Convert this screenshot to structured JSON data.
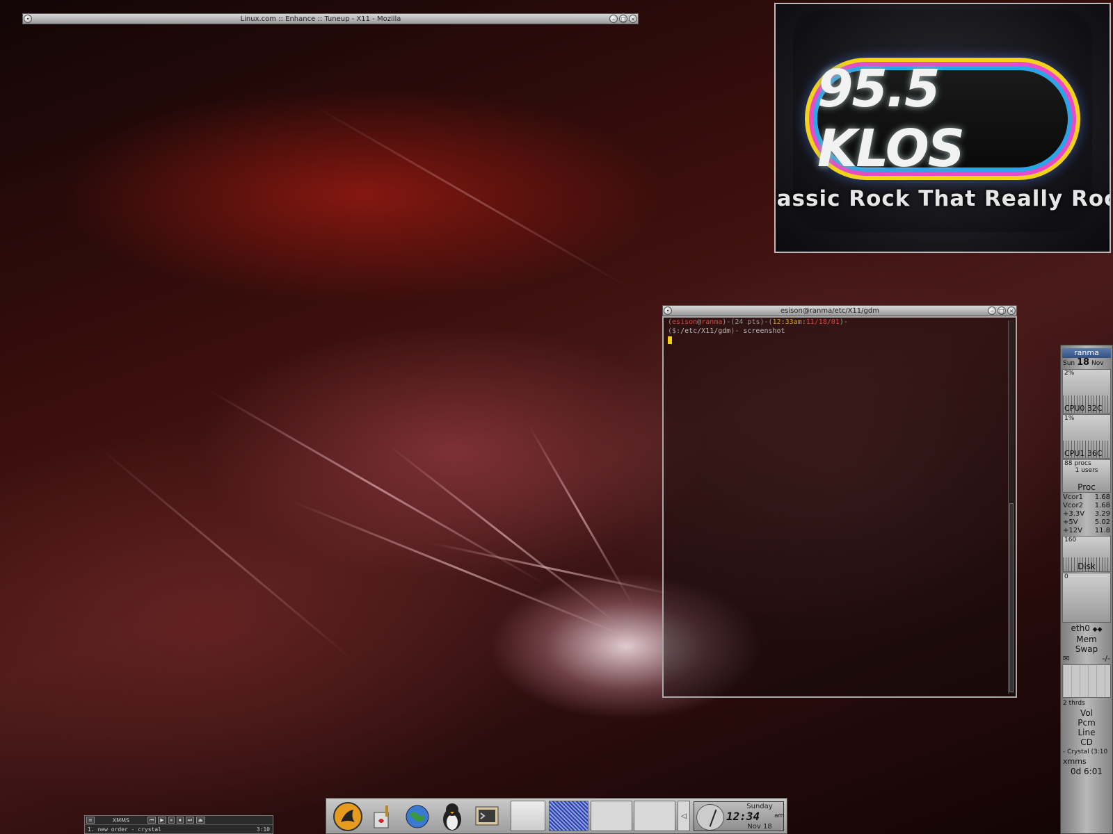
{
  "mozilla": {
    "title": "Linux.com :: Enhance :: Tuneup - X11 - Mozilla"
  },
  "video": {
    "logo": "95.5 KLOS",
    "slogan": "lassic Rock That Really Rock"
  },
  "terminal": {
    "title": "esison@ranma/etc/X11/gdm",
    "prompt_user": "esison",
    "prompt_host": "ranma",
    "prompt_tty": "24 pts",
    "prompt_time": "12:33am",
    "prompt_date": "11/18/01",
    "prompt_cwd": "/etc/X11/gdm",
    "command": "screenshot"
  },
  "gkrellm": {
    "host": "ranma",
    "day": "Sun",
    "date": "18",
    "month": "Nov",
    "cpu0_pct": "2%",
    "cpu0_label": "CPU0",
    "cpu0_temp": "32C",
    "cpu1_pct": "1%",
    "cpu1_label": "CPU1",
    "cpu1_temp": "36C",
    "procs": "88 procs",
    "users": "1 users",
    "proc_label": "Proc",
    "sensors": [
      {
        "name": "Vcor1",
        "value": "1.68"
      },
      {
        "name": "Vcor2",
        "value": "1.68"
      },
      {
        "name": "+3.3V",
        "value": "3.29"
      },
      {
        "name": "+5V",
        "value": "5.02"
      },
      {
        "name": "+12V",
        "value": "11.8"
      }
    ],
    "proc_scale": "160",
    "disk_label": "Disk",
    "disk_scale": "0",
    "net_label": "eth0",
    "mem_label": "Mem",
    "swap_label": "Swap",
    "mail_label": "-/-",
    "threads": "2 thrds",
    "vol_label": "Vol",
    "pcm_label": "Pcm",
    "line_label": "Line",
    "cd_label": "CD",
    "track": "- Crystal (3:10",
    "player": "xmms",
    "uptime": "0d 6:01"
  },
  "xmms": {
    "title": "XMMS",
    "track": "1. new order - crystal",
    "time": "3:10"
  },
  "clock": {
    "day": "Sunday",
    "time": "12:34",
    "ampm": "am",
    "date": "Nov 18"
  },
  "colors": {
    "prompt_red": "#dd4444",
    "cursor": "#f2d600",
    "titlebar": "#bcbcbc"
  },
  "icons": [
    "gnome-foot-icon",
    "paint-icon",
    "globe-icon",
    "penguin-icon",
    "terminal-icon"
  ]
}
